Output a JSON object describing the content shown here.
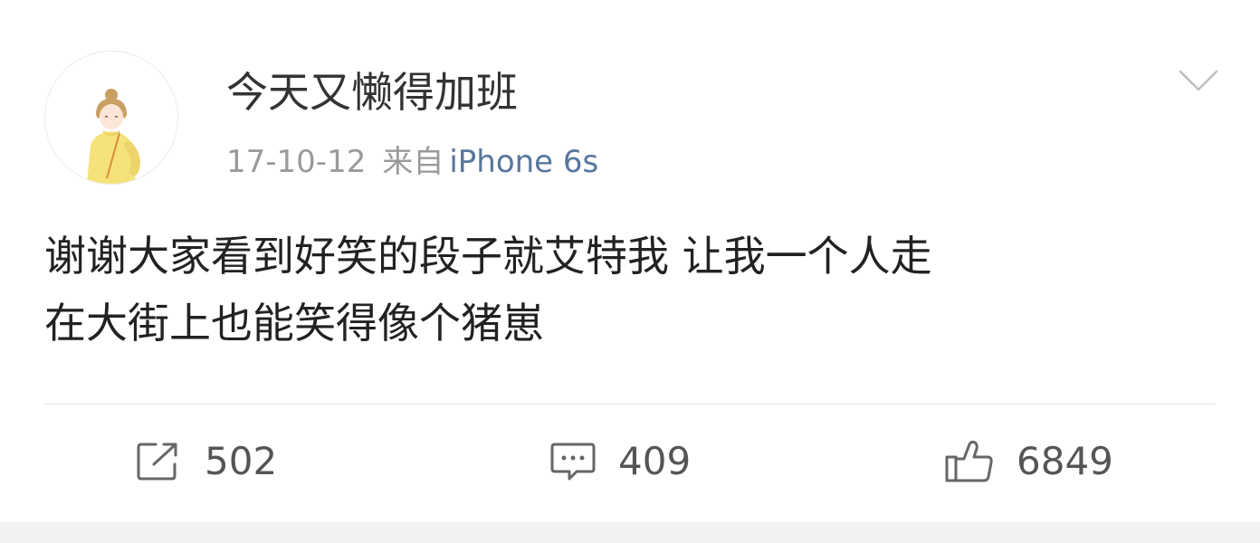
{
  "post": {
    "username": "今天又懒得加班",
    "date": "17-10-12",
    "from_label": "来自",
    "device": "iPhone 6s",
    "content_line1": "谢谢大家看到好笑的段子就艾特我 让我一个人走",
    "content_line2": "在大街上也能笑得像个猪崽"
  },
  "actions": {
    "share_count": "502",
    "comment_count": "409",
    "like_count": "6849"
  },
  "icons": {
    "more": "chevron-down-icon",
    "share": "share-icon",
    "comment": "comment-icon",
    "like": "thumbs-up-icon"
  },
  "colors": {
    "username": "#333333",
    "meta": "#9a9a9a",
    "device_link": "#56779d",
    "content": "#222222",
    "action_text": "#555555"
  }
}
